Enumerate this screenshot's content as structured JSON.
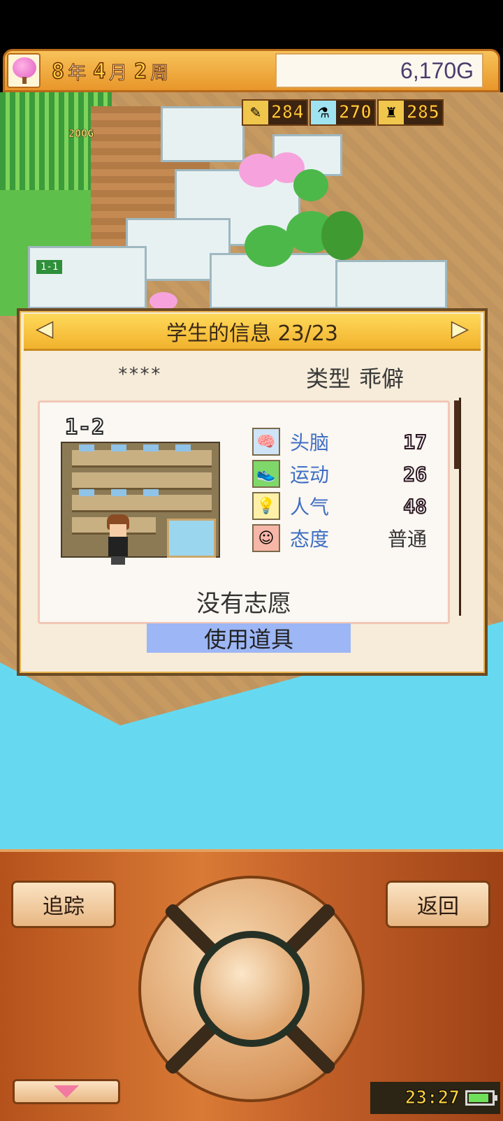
{
  "header": {
    "year": "8",
    "year_unit": "年",
    "month": "4",
    "month_unit": "月",
    "week": "2",
    "week_unit": "周",
    "money": "6,170G",
    "season_icon": "cherry-blossom-tree"
  },
  "stats": [
    {
      "icon": "pencil-icon",
      "value": "284"
    },
    {
      "icon": "flask-icon",
      "value": "270"
    },
    {
      "icon": "trophy-icon",
      "value": "285"
    }
  ],
  "map": {
    "coin_popup": "200G",
    "room_sign": "1-1"
  },
  "panel": {
    "title": "学生的信息 23/23",
    "student_name": "****",
    "type_label": "类型",
    "type_value": "乖僻",
    "class_tag": "1-2",
    "attributes": [
      {
        "icon": "brain-icon",
        "label": "头脑",
        "value": "17"
      },
      {
        "icon": "sneaker-icon",
        "label": "运动",
        "value": "26"
      },
      {
        "icon": "lightbulb-icon",
        "label": "人气",
        "value": "48"
      },
      {
        "icon": "smiley-icon",
        "label": "态度",
        "value": "普通"
      }
    ],
    "wish": "没有志愿",
    "use_item_label": "使用道具"
  },
  "controller": {
    "track_label": "追踪",
    "back_label": "返回",
    "time": "23:27"
  }
}
